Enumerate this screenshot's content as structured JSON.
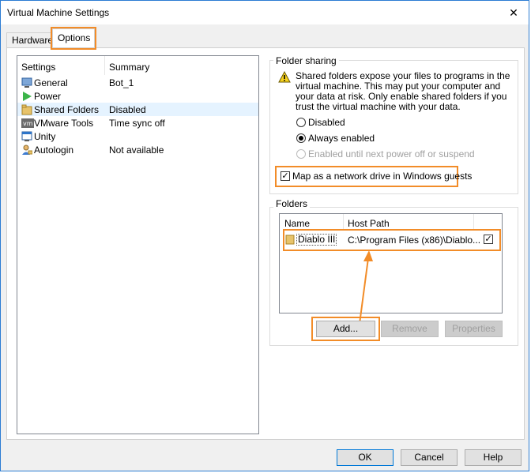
{
  "window": {
    "title": "Virtual Machine Settings",
    "close_glyph": "✕"
  },
  "tabs": [
    {
      "label": "Hardware"
    },
    {
      "label": "Options"
    }
  ],
  "settings": {
    "col_settings": "Settings",
    "col_summary": "Summary",
    "rows": [
      {
        "name": "General",
        "summary": "Bot_1",
        "icon": "general-icon"
      },
      {
        "name": "Power",
        "summary": "",
        "icon": "power-icon"
      },
      {
        "name": "Shared Folders",
        "summary": "Disabled",
        "icon": "shared-folders-icon"
      },
      {
        "name": "VMware Tools",
        "summary": "Time sync off",
        "icon": "vmware-tools-icon"
      },
      {
        "name": "Unity",
        "summary": "",
        "icon": "unity-icon"
      },
      {
        "name": "Autologin",
        "summary": "Not available",
        "icon": "autologin-icon"
      }
    ]
  },
  "folder_sharing": {
    "title": "Folder sharing",
    "warning_lines": [
      "Shared folders expose your files to programs in the",
      "virtual machine. This may put your computer and",
      "your data at risk. Only enable shared folders if you",
      "trust the virtual machine with your data."
    ],
    "options": [
      {
        "label": "Disabled",
        "checked": false,
        "disabled": false
      },
      {
        "label": "Always enabled",
        "checked": true,
        "disabled": false
      },
      {
        "label": "Enabled until next power off or suspend",
        "checked": false,
        "disabled": true
      }
    ],
    "map_drive_label": "Map as a network drive in Windows guests",
    "map_drive_checked": true
  },
  "folders": {
    "title": "Folders",
    "col_name": "Name",
    "col_host_path": "Host Path",
    "rows": [
      {
        "name": "Diablo III",
        "host_path": "C:\\Program Files (x86)\\Diablo...",
        "enabled": true
      }
    ],
    "buttons": {
      "add": "Add...",
      "remove": "Remove",
      "properties": "Properties"
    }
  },
  "footer": {
    "ok": "OK",
    "cancel": "Cancel",
    "help": "Help"
  },
  "colors": {
    "highlight": "#f28c28",
    "accent": "#0078d7"
  }
}
